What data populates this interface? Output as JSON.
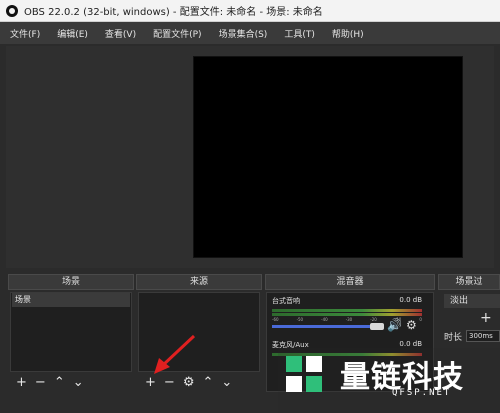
{
  "window": {
    "title": "OBS 22.0.2 (32-bit, windows) - 配置文件: 未命名 - 场景: 未命名"
  },
  "menu": [
    "文件(F)",
    "编辑(E)",
    "查看(V)",
    "配置文件(P)",
    "场景集合(S)",
    "工具(T)",
    "帮助(H)"
  ],
  "docks": {
    "scenes": {
      "title": "场景",
      "items": [
        "场景"
      ],
      "toolbar": [
        "+",
        "−",
        "⌃",
        "⌄"
      ]
    },
    "sources": {
      "title": "来源",
      "toolbar": [
        "+",
        "−",
        "⚙",
        "⌃",
        "⌄"
      ]
    },
    "mixer": {
      "title": "混音器",
      "tracks": [
        {
          "name": "台式音响",
          "level": "0.0 dB",
          "volume_fraction": 0.85
        },
        {
          "name": "麦克风/Aux",
          "level": "0.0 dB",
          "volume_fraction": 0.85
        }
      ],
      "ticks": [
        "-60",
        "-55",
        "-50",
        "-45",
        "-40",
        "-35",
        "-30",
        "-25",
        "-20",
        "-15",
        "-10",
        "-5",
        "0"
      ]
    },
    "transitions": {
      "title": "场景过",
      "mode": "淡出",
      "add": "+",
      "duration_label": "时长",
      "duration_value": "300ms"
    }
  },
  "watermark": {
    "main": "量链科技",
    "sub": "QFSP.NET"
  },
  "colors": {
    "arrow": "#e02020",
    "accent": "#4a6ad8",
    "watermark_green": "#2fbf7a"
  }
}
